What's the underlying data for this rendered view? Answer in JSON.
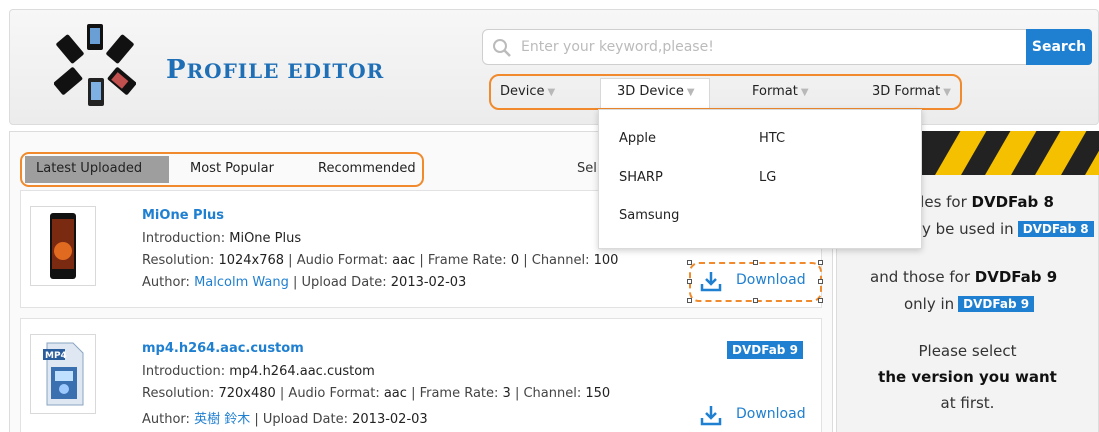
{
  "header": {
    "brand_big": "P",
    "brand_rest": "ROFILE EDITOR",
    "search_placeholder": "Enter your keyword,please!",
    "search_button": "Search",
    "nav": [
      "Device",
      "3D Device",
      "Format",
      "3D Format"
    ]
  },
  "dropdown": {
    "items": [
      "Apple",
      "HTC",
      "SHARP",
      "LG",
      "Samsung"
    ]
  },
  "tabs": [
    "Latest Uploaded",
    "Most Popular",
    "Recommended"
  ],
  "select_label": "Sel",
  "items": [
    {
      "title": "MiOne Plus",
      "introduction_label": "Introduction: ",
      "introduction": "MiOne Plus",
      "resolution_label": "Resolution: ",
      "resolution": "1024x768",
      "audio_label": " | Audio Format: ",
      "audio": "aac",
      "frame_label": " | Frame Rate: ",
      "frame": "0",
      "channel_label": " | Channel: ",
      "channel": "100",
      "author_label": "Author: ",
      "author": "Malcolm Wang",
      "date_label": " | Upload Date: ",
      "date": "2013-02-03",
      "download": "Download"
    },
    {
      "title": "mp4.h264.aac.custom",
      "introduction_label": "Introduction: ",
      "introduction": "mp4.h264.aac.custom",
      "resolution_label": "Resolution: ",
      "resolution": "720x480",
      "audio_label": " | Audio Format: ",
      "audio": "aac",
      "frame_label": " | Frame Rate: ",
      "frame": "3",
      "channel_label": " | Channel: ",
      "channel": "150",
      "author_label": "Author: ",
      "author": "英樹 鈴木",
      "date_label": " | Upload Date: ",
      "date": "2013-02-03",
      "badge": "DVDFab 9",
      "download": "Download"
    }
  ],
  "sidebar": {
    "line1_prefix": "iles for ",
    "line1_bold": "DVDFab 8",
    "line2_prefix": "y be used in",
    "line2_badge": "DVDFab 8",
    "line3_prefix": "and those for ",
    "line3_bold": "DVDFab 9",
    "line4_prefix": "only in",
    "line4_badge": "DVDFab 9",
    "line5": "Please select",
    "line6": "the version you want",
    "line7": "at first."
  },
  "colors": {
    "accent": "#1f7fd0",
    "highlight": "#f08a2c",
    "stripe": "#f5c000"
  }
}
